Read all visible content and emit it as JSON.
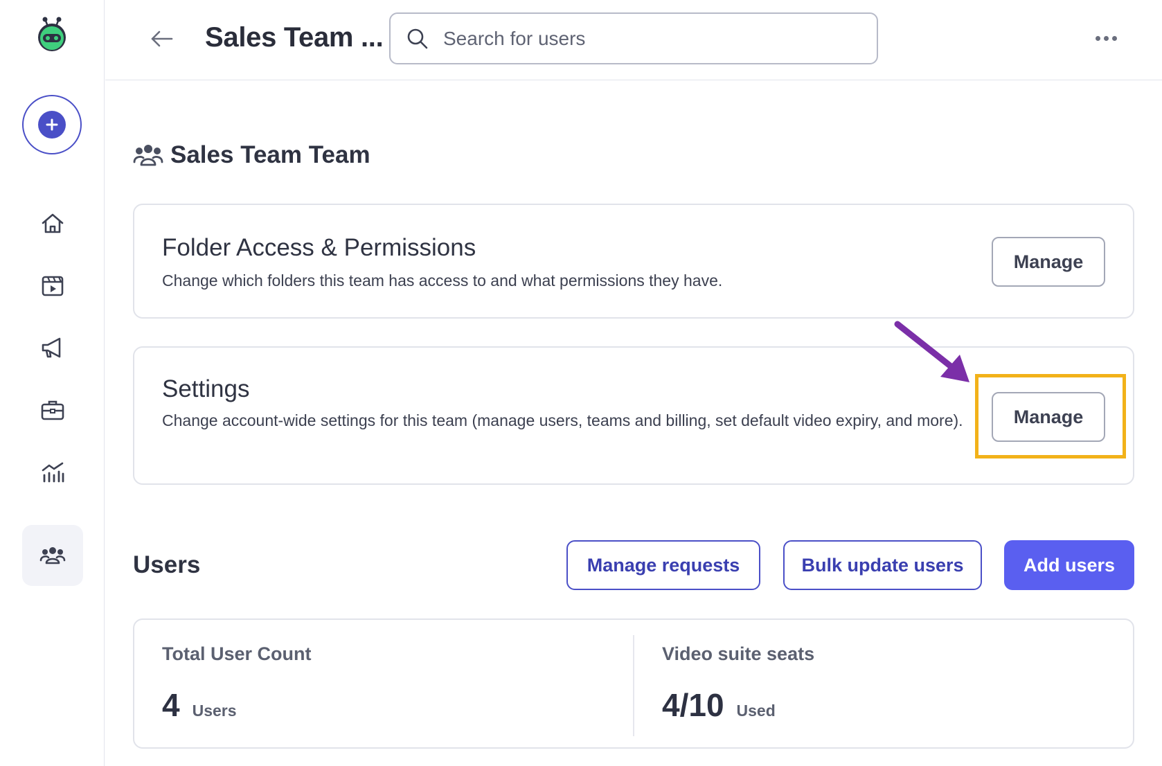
{
  "header": {
    "title": "Sales Team ...",
    "search_placeholder": "Search for users"
  },
  "team": {
    "heading": "Sales Team Team"
  },
  "cards": {
    "folder_access": {
      "title": "Folder Access & Permissions",
      "description": "Change which folders this team has access to and what permissions they have.",
      "button": "Manage"
    },
    "settings": {
      "title": "Settings",
      "description": "Change account-wide settings for this team (manage users, teams and billing, set default video expiry, and more).",
      "button": "Manage"
    }
  },
  "users": {
    "heading": "Users",
    "manage_requests": "Manage requests",
    "bulk_update": "Bulk update users",
    "add_users": "Add users"
  },
  "stats": {
    "total_user_count": {
      "label": "Total User Count",
      "value": "4",
      "unit": "Users"
    },
    "video_suite_seats": {
      "label": "Video suite seats",
      "value": "4/10",
      "unit": "Used"
    }
  },
  "sidebar": {
    "items": [
      {
        "icon": "home-icon"
      },
      {
        "icon": "video-library-icon"
      },
      {
        "icon": "megaphone-icon"
      },
      {
        "icon": "briefcase-icon"
      },
      {
        "icon": "analytics-icon"
      },
      {
        "icon": "team-icon",
        "active": true
      }
    ]
  },
  "colors": {
    "accent": "#4a4fc7",
    "primary_button": "#5a5ff0",
    "highlight": "#f2b21a",
    "arrow": "#7b2fa8",
    "logo": "#3fcf7d"
  }
}
